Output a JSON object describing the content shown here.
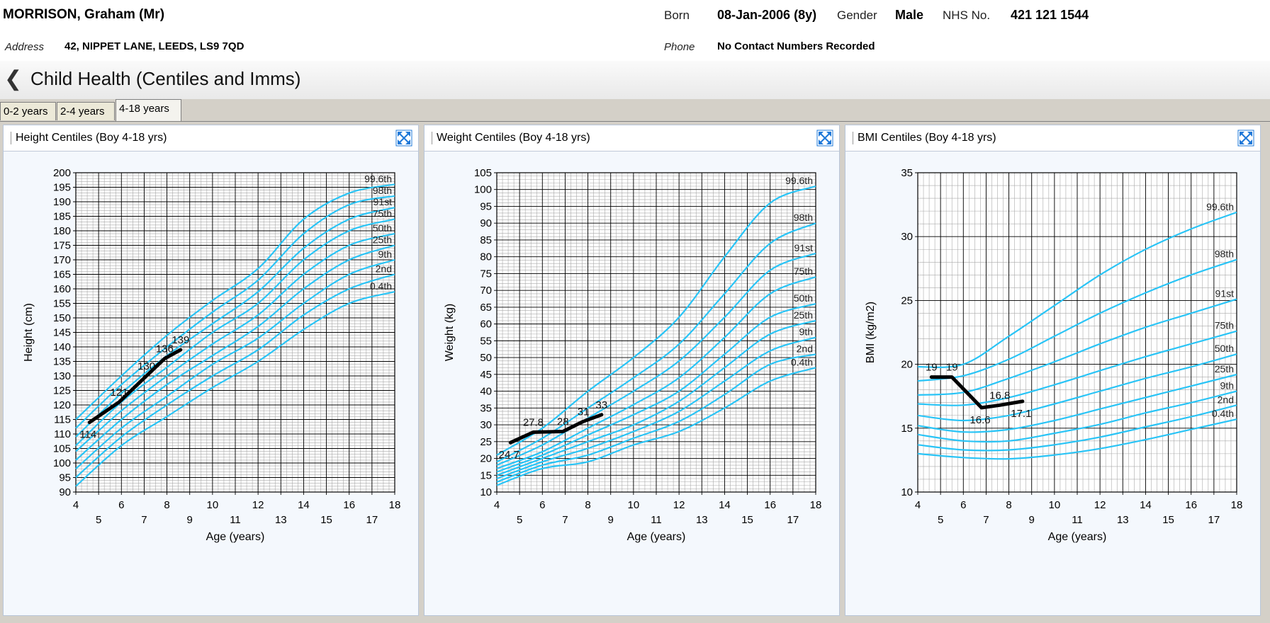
{
  "patient": {
    "name": "MORRISON, Graham (Mr)",
    "born_label": "Born",
    "born_value": "08-Jan-2006 (8y)",
    "gender_label": "Gender",
    "gender_value": "Male",
    "nhs_label": "NHS No.",
    "nhs_value": "421 121 1544",
    "address_label": "Address",
    "address_value": "42, NIPPET LANE, LEEDS, LS9 7QD",
    "phone_label": "Phone",
    "phone_value": "No Contact Numbers Recorded"
  },
  "page": {
    "title": "Child Health (Centiles and Imms)",
    "back_icon": "chevron-left-icon"
  },
  "tabs": [
    {
      "label": "0-2 years",
      "active": false
    },
    {
      "label": "2-4 years",
      "active": false
    },
    {
      "label": "4-18 years",
      "active": true
    }
  ],
  "colors": {
    "centile": "#29c4f6",
    "patient": "#000000",
    "grid_major": "#000000",
    "grid_minor": "#a9a9a9",
    "panel_bg": "#f4f8fd"
  },
  "chart_data": [
    {
      "type": "line",
      "title": "Height Centiles (Boy 4-18 yrs)",
      "xlabel": "Age (years)",
      "ylabel": "Height (cm)",
      "xlim": [
        4,
        18
      ],
      "ylim": [
        90,
        200
      ],
      "ytick_step": 5,
      "grid": true,
      "x_bottom_ticks": [
        "4",
        "6",
        "8",
        "10",
        "12",
        "14",
        "16",
        "18"
      ],
      "x_top_ticks": [
        "5",
        "7",
        "9",
        "11",
        "13",
        "15",
        "17"
      ],
      "centile_x": [
        4,
        6,
        8,
        10,
        12,
        14,
        16,
        18
      ],
      "centiles": [
        {
          "label": "99.6th",
          "values": [
            115,
            130,
            144,
            156,
            167,
            184,
            193,
            196
          ]
        },
        {
          "label": "98th",
          "values": [
            112,
            127,
            140,
            152,
            163,
            179,
            189,
            192
          ]
        },
        {
          "label": "91st",
          "values": [
            109,
            124,
            137,
            148,
            159,
            174,
            184,
            188
          ]
        },
        {
          "label": "75th",
          "values": [
            106,
            121,
            133,
            145,
            155,
            170,
            180,
            184
          ]
        },
        {
          "label": "50th",
          "values": [
            104,
            118,
            130,
            141,
            151,
            165,
            175,
            179
          ]
        },
        {
          "label": "25th",
          "values": [
            101,
            115,
            127,
            137,
            147,
            160,
            170,
            175
          ]
        },
        {
          "label": "9th",
          "values": [
            98,
            112,
            123,
            134,
            143,
            155,
            165,
            170
          ]
        },
        {
          "label": "2nd",
          "values": [
            95,
            109,
            120,
            130,
            139,
            151,
            160,
            165
          ]
        },
        {
          "label": "0.4th",
          "values": [
            92,
            106,
            116,
            126,
            135,
            146,
            155,
            159
          ]
        }
      ],
      "patient_series": {
        "x": [
          4.6,
          5.9,
          7.1,
          7.9,
          8.6
        ],
        "y": [
          114,
          121,
          130,
          136,
          139
        ]
      },
      "patient_labels": [
        {
          "x": 4.6,
          "y": 114,
          "text": "114",
          "pos": "below"
        },
        {
          "x": 5.9,
          "y": 121,
          "text": "121",
          "pos": "above"
        },
        {
          "x": 7.1,
          "y": 130,
          "text": "130",
          "pos": "above"
        },
        {
          "x": 7.9,
          "y": 136,
          "text": "136",
          "pos": "above"
        },
        {
          "x": 8.6,
          "y": 139,
          "text": "139",
          "pos": "above"
        }
      ]
    },
    {
      "type": "line",
      "title": "Weight Centiles (Boy 4-18 yrs)",
      "xlabel": "Age (years)",
      "ylabel": "Weight (kg)",
      "xlim": [
        4,
        18
      ],
      "ylim": [
        10,
        105
      ],
      "ytick_step": 5,
      "grid": true,
      "x_bottom_ticks": [
        "4",
        "6",
        "8",
        "10",
        "12",
        "14",
        "16",
        "18"
      ],
      "x_top_ticks": [
        "5",
        "7",
        "9",
        "11",
        "13",
        "15",
        "17"
      ],
      "centile_x": [
        4,
        6,
        8,
        10,
        12,
        14,
        16,
        18
      ],
      "centiles": [
        {
          "label": "99.6th",
          "values": [
            21,
            29,
            40,
            50,
            62,
            80,
            96,
            101
          ]
        },
        {
          "label": "98th",
          "values": [
            19,
            26,
            35,
            44,
            54,
            69,
            84,
            90
          ]
        },
        {
          "label": "91st",
          "values": [
            18,
            24,
            32,
            40,
            49,
            62,
            76,
            81
          ]
        },
        {
          "label": "75th",
          "values": [
            17,
            22,
            29,
            36,
            44,
            56,
            69,
            74
          ]
        },
        {
          "label": "50th",
          "values": [
            16,
            21,
            27,
            33,
            40,
            51,
            62,
            66
          ]
        },
        {
          "label": "25th",
          "values": [
            15,
            20,
            25,
            30,
            37,
            47,
            57,
            61
          ]
        },
        {
          "label": "9th",
          "values": [
            14,
            19,
            23,
            28,
            34,
            43,
            52,
            56
          ]
        },
        {
          "label": "2nd",
          "values": [
            13,
            18,
            21,
            26,
            31,
            39,
            48,
            51
          ]
        },
        {
          "label": "0.4th",
          "values": [
            12,
            17,
            19,
            24,
            28,
            35,
            43,
            47
          ]
        }
      ],
      "patient_series": {
        "x": [
          4.6,
          5.6,
          6.9,
          7.8,
          8.6
        ],
        "y": [
          24.7,
          27.8,
          28,
          31,
          33
        ]
      },
      "patient_labels": [
        {
          "x": 4.6,
          "y": 24.7,
          "text": "24.7",
          "pos": "below"
        },
        {
          "x": 5.6,
          "y": 27.8,
          "text": "27.8",
          "pos": "above"
        },
        {
          "x": 6.9,
          "y": 28,
          "text": "28",
          "pos": "above"
        },
        {
          "x": 7.8,
          "y": 31,
          "text": "31",
          "pos": "above"
        },
        {
          "x": 8.6,
          "y": 33,
          "text": "33",
          "pos": "above"
        }
      ]
    },
    {
      "type": "line",
      "title": "BMI Centiles (Boy 4-18 yrs)",
      "xlabel": "Age (years)",
      "ylabel": "BMI (kg/m2)",
      "xlim": [
        4,
        18
      ],
      "ylim": [
        10,
        35
      ],
      "ytick_step": 5,
      "grid": true,
      "x_bottom_ticks": [
        "4",
        "6",
        "8",
        "10",
        "12",
        "14",
        "16",
        "18"
      ],
      "x_top_ticks": [
        "5",
        "7",
        "9",
        "11",
        "13",
        "15",
        "17"
      ],
      "centile_x": [
        4,
        6,
        8,
        10,
        12,
        14,
        16,
        18
      ],
      "centiles": [
        {
          "label": "99.6th",
          "values": [
            19.8,
            20.0,
            22.2,
            24.6,
            27.0,
            29.0,
            30.6,
            31.9
          ]
        },
        {
          "label": "98th",
          "values": [
            18.7,
            19.1,
            20.4,
            22.2,
            24.0,
            25.6,
            27.0,
            28.2
          ]
        },
        {
          "label": "91st",
          "values": [
            17.6,
            17.8,
            18.9,
            20.2,
            21.6,
            22.9,
            24.0,
            25.1
          ]
        },
        {
          "label": "75th",
          "values": [
            16.9,
            16.8,
            17.4,
            18.4,
            19.5,
            20.6,
            21.6,
            22.6
          ]
        },
        {
          "label": "50th",
          "values": [
            16.0,
            15.6,
            16.0,
            16.9,
            17.9,
            18.9,
            19.8,
            20.8
          ]
        },
        {
          "label": "25th",
          "values": [
            15.2,
            14.7,
            14.9,
            15.6,
            16.5,
            17.4,
            18.3,
            19.2
          ]
        },
        {
          "label": "9th",
          "values": [
            14.5,
            14.0,
            14.0,
            14.6,
            15.3,
            16.2,
            17.0,
            17.9
          ]
        },
        {
          "label": "2nd",
          "values": [
            13.7,
            13.3,
            13.3,
            13.7,
            14.3,
            15.1,
            15.9,
            16.8
          ]
        },
        {
          "label": "0.4th",
          "values": [
            13.0,
            12.7,
            12.6,
            12.9,
            13.4,
            14.1,
            14.9,
            15.7
          ]
        }
      ],
      "patient_series": {
        "x": [
          4.6,
          5.5,
          6.8,
          7.6,
          8.6
        ],
        "y": [
          19,
          19,
          16.6,
          16.8,
          17.1
        ]
      },
      "patient_labels": [
        {
          "x": 4.6,
          "y": 19,
          "text": "19",
          "pos": "above"
        },
        {
          "x": 5.5,
          "y": 19,
          "text": "19",
          "pos": "above"
        },
        {
          "x": 6.8,
          "y": 16.6,
          "text": "16.6",
          "pos": "below"
        },
        {
          "x": 7.6,
          "y": 16.8,
          "text": "16.8",
          "pos": "above"
        },
        {
          "x": 8.6,
          "y": 17.1,
          "text": "17.1",
          "pos": "below"
        }
      ]
    }
  ]
}
